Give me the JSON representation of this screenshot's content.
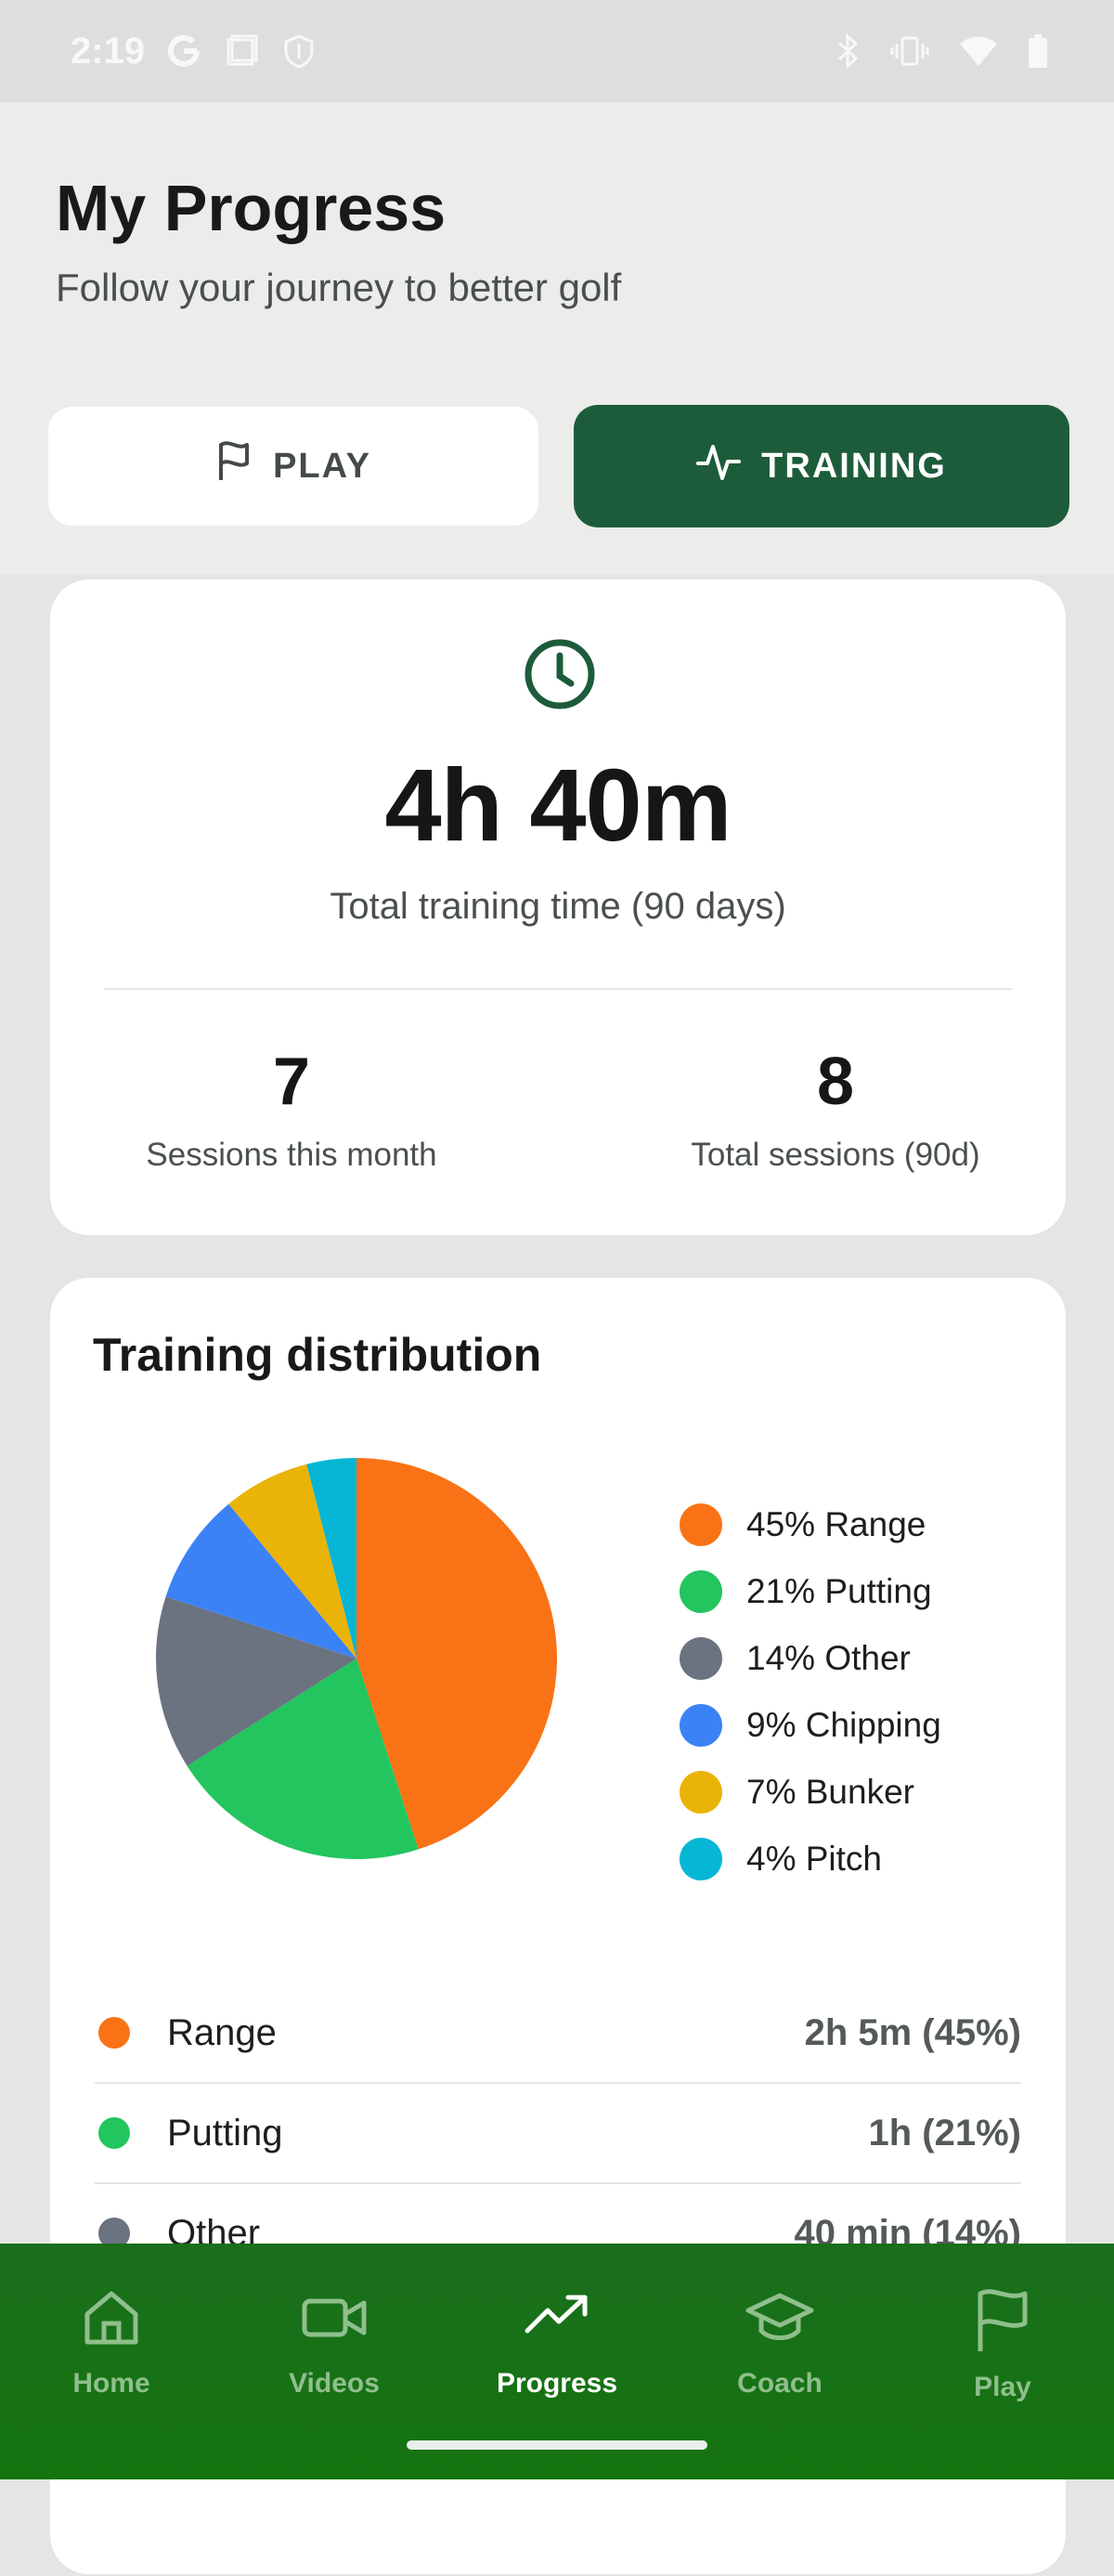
{
  "status_bar": {
    "time": "2:19"
  },
  "header": {
    "title": "My Progress",
    "subtitle": "Follow your journey to better golf"
  },
  "tabs": {
    "play_label": "PLAY",
    "training_label": "TRAINING",
    "active": "training"
  },
  "stats": {
    "total_time": "4h 40m",
    "total_time_label": "Total training time (90 days)",
    "sessions_month": "7",
    "sessions_month_label": "Sessions this month",
    "sessions_total": "8",
    "sessions_total_label": "Total sessions (90d)"
  },
  "distribution": {
    "title": "Training distribution",
    "legend": [
      {
        "label": "45% Range",
        "color": "#f97316"
      },
      {
        "label": "21% Putting",
        "color": "#22c55e"
      },
      {
        "label": "14% Other",
        "color": "#6b7280"
      },
      {
        "label": "9% Chipping",
        "color": "#3b82f6"
      },
      {
        "label": "7% Bunker",
        "color": "#eab308"
      },
      {
        "label": "4% Pitch",
        "color": "#06b6d4"
      }
    ],
    "rows": [
      {
        "name": "Range",
        "value": "2h 5m (45%)",
        "color": "#f97316"
      },
      {
        "name": "Putting",
        "value": "1h (21%)",
        "color": "#22c55e"
      },
      {
        "name": "Other",
        "value": "40 min (14%)",
        "color": "#6b7280"
      }
    ]
  },
  "chart_data": {
    "type": "pie",
    "title": "Training distribution",
    "categories": [
      "Range",
      "Putting",
      "Other",
      "Chipping",
      "Bunker",
      "Pitch"
    ],
    "values": [
      45,
      21,
      14,
      9,
      7,
      4
    ],
    "colors": [
      "#f97316",
      "#22c55e",
      "#6b7280",
      "#3b82f6",
      "#eab308",
      "#06b6d4"
    ],
    "legend": "right"
  },
  "nav": {
    "items": [
      {
        "label": "Home",
        "icon": "home-icon"
      },
      {
        "label": "Videos",
        "icon": "video-icon"
      },
      {
        "label": "Progress",
        "icon": "trending-up-icon"
      },
      {
        "label": "Coach",
        "icon": "graduation-cap-icon"
      },
      {
        "label": "Play",
        "icon": "flag-icon"
      }
    ],
    "active": "Progress"
  }
}
